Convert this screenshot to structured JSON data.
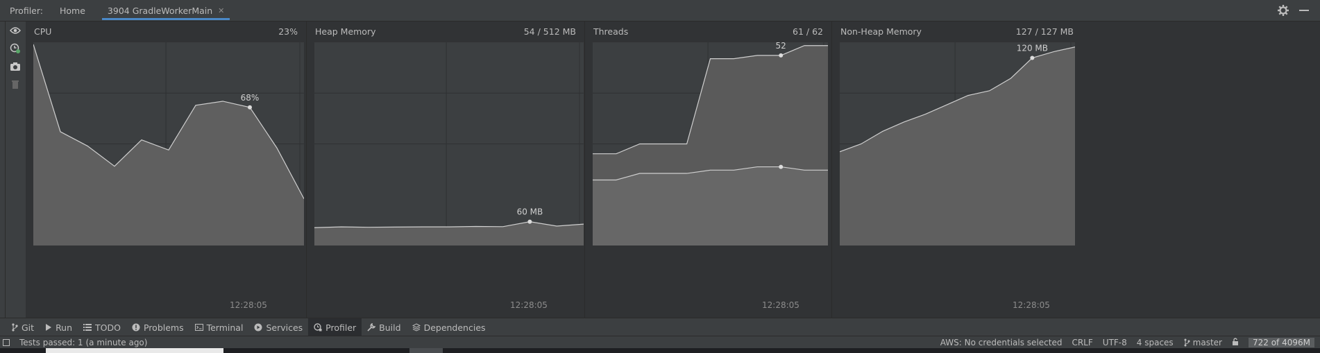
{
  "header": {
    "title": "Profiler:",
    "tabs": [
      {
        "label": "Home"
      },
      {
        "label": "3904 GradleWorkerMain"
      }
    ]
  },
  "panels": {
    "cpu": {
      "title": "CPU",
      "value": "23%",
      "marker_label": "68%",
      "time": "12:28:05"
    },
    "heap": {
      "title": "Heap Memory",
      "value": "54 / 512 MB",
      "marker_label": "60 MB",
      "time": "12:28:05"
    },
    "threads": {
      "title": "Threads",
      "value": "61 / 62",
      "marker_label": "52",
      "time": "12:28:05"
    },
    "nonheap": {
      "title": "Non-Heap Memory",
      "value": "127 / 127 MB",
      "marker_label": "120 MB",
      "time": "12:28:05"
    }
  },
  "series": {
    "cpu": [
      99,
      56,
      49,
      39,
      52,
      47,
      69,
      71,
      68,
      48,
      23
    ],
    "heap_mb": [
      45,
      47,
      46,
      46.5,
      47,
      47,
      48,
      47.5,
      60,
      49,
      54
    ],
    "threads_upper": [
      28,
      28,
      31,
      31,
      31,
      57,
      57,
      58,
      58,
      61,
      61
    ],
    "threads_lower": [
      20,
      20,
      22,
      22,
      22,
      23,
      23,
      24,
      24,
      23,
      23
    ],
    "nonheap_mb": [
      60,
      65,
      73,
      79,
      84,
      90,
      96,
      99,
      107,
      120,
      124,
      127
    ]
  },
  "toolbar": {
    "items": [
      {
        "label": "Git",
        "icon": "git-icon"
      },
      {
        "label": "Run",
        "icon": "run-icon"
      },
      {
        "label": "TODO",
        "icon": "todo-icon"
      },
      {
        "label": "Problems",
        "icon": "problems-icon"
      },
      {
        "label": "Terminal",
        "icon": "terminal-icon"
      },
      {
        "label": "Services",
        "icon": "services-icon"
      },
      {
        "label": "Profiler",
        "icon": "profiler-icon"
      },
      {
        "label": "Build",
        "icon": "build-icon"
      },
      {
        "label": "Dependencies",
        "icon": "dependencies-icon"
      }
    ]
  },
  "status": {
    "message": "Tests passed: 1 (a minute ago)",
    "aws": "AWS: No credentials selected",
    "line_sep": "CRLF",
    "encoding": "UTF-8",
    "indent": "4 spaces",
    "branch": "master",
    "memory": "722 of 4096M"
  },
  "colors": {
    "accent": "#4a88c7",
    "plot_bg": "#3c3f41",
    "fill": "#606060",
    "line": "#cfcfcf"
  }
}
